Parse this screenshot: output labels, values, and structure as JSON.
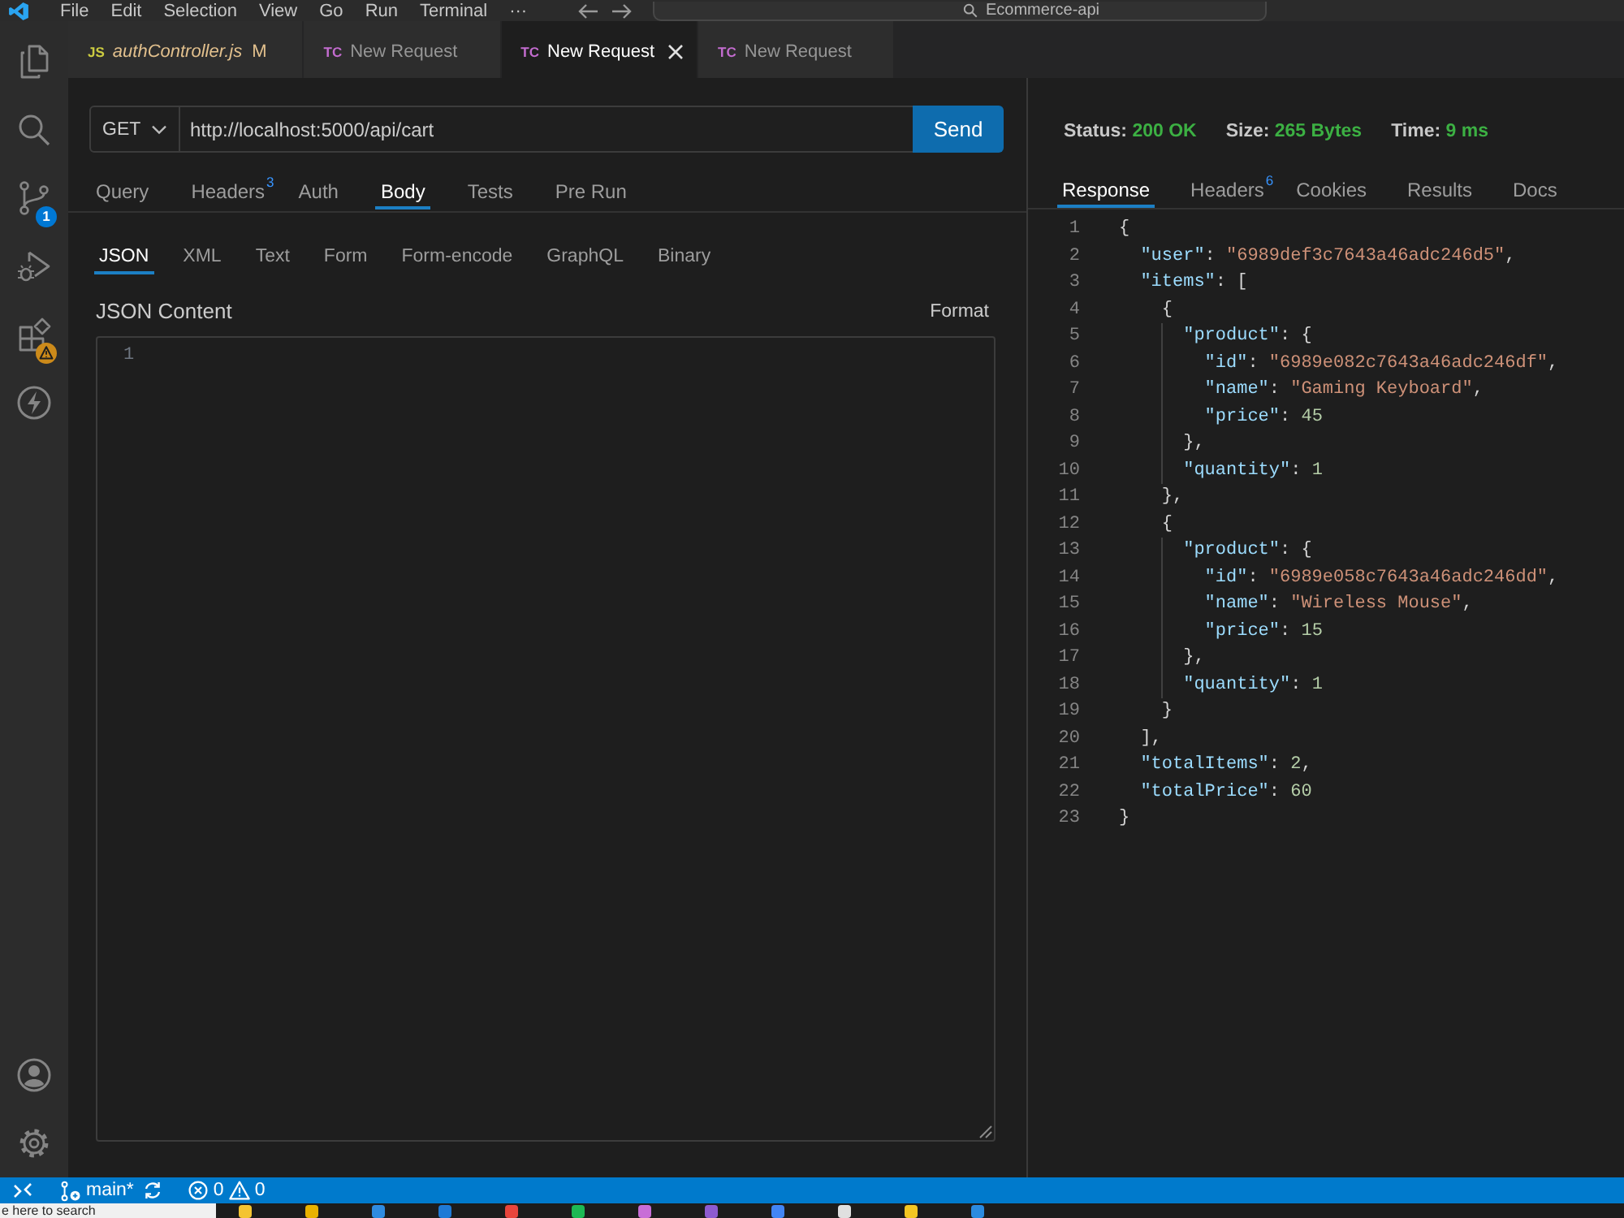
{
  "title_bar": {
    "menu": [
      "File",
      "Edit",
      "Selection",
      "View",
      "Go",
      "Run",
      "Terminal",
      "···"
    ],
    "search": {
      "value": "Ecommerce-api"
    }
  },
  "activity_bar": {
    "source_control_badge": "1",
    "extensions_warning": true
  },
  "editor_tabs": [
    {
      "kind": "js",
      "icon_text": "JS",
      "label": "authController.js",
      "preview": true,
      "status": "M",
      "selected": false
    },
    {
      "kind": "tc",
      "icon_text": "TC",
      "label": "New Request",
      "preview": false,
      "selected": false
    },
    {
      "kind": "tc",
      "icon_text": "TC",
      "label": "New Request",
      "preview": false,
      "selected": true
    },
    {
      "kind": "tc",
      "icon_text": "TC",
      "label": "New Request",
      "preview": false,
      "selected": false
    }
  ],
  "request": {
    "method": "GET",
    "url": "http://localhost:5000/api/cart",
    "send_label": "Send",
    "tabs": [
      {
        "label": "Query",
        "selected": false
      },
      {
        "label": "Headers",
        "count": "3",
        "selected": false
      },
      {
        "label": "Auth",
        "selected": false
      },
      {
        "label": "Body",
        "selected": true
      },
      {
        "label": "Tests",
        "selected": false
      },
      {
        "label": "Pre Run",
        "selected": false
      }
    ],
    "body_types": [
      {
        "label": "JSON",
        "selected": true
      },
      {
        "label": "XML",
        "selected": false
      },
      {
        "label": "Text",
        "selected": false
      },
      {
        "label": "Form",
        "selected": false
      },
      {
        "label": "Form-encode",
        "selected": false
      },
      {
        "label": "GraphQL",
        "selected": false
      },
      {
        "label": "Binary",
        "selected": false
      }
    ],
    "content": {
      "title": "JSON Content",
      "format_label": "Format",
      "line_numbers": [
        "1"
      ]
    }
  },
  "response": {
    "status": [
      {
        "label": "Status:",
        "value": "200 OK"
      },
      {
        "label": "Size:",
        "value": "265 Bytes"
      },
      {
        "label": "Time:",
        "value": "9 ms"
      }
    ],
    "tabs": [
      {
        "label": "Response",
        "selected": true
      },
      {
        "label": "Headers",
        "count": "6",
        "selected": false
      },
      {
        "label": "Cookies",
        "selected": false
      },
      {
        "label": "Results",
        "selected": false
      },
      {
        "label": "Docs",
        "selected": false
      }
    ],
    "lines": [
      {
        "number": "1",
        "tokens": [
          {
            "kind": "punct",
            "text": "{"
          }
        ],
        "children": [
          {
            "number": "2",
            "tokens": [
              {
                "kind": "key",
                "text": "\"user\""
              },
              {
                "kind": "punct",
                "text": ": "
              },
              {
                "kind": "string",
                "text": "\"6989def3c7643a46adc246d5\""
              },
              {
                "kind": "punct",
                "text": ","
              }
            ]
          },
          {
            "number": "3",
            "tokens": [
              {
                "kind": "key",
                "text": "\"items\""
              },
              {
                "kind": "punct",
                "text": ": ["
              }
            ],
            "children": [
              {
                "number": "4",
                "tokens": [
                  {
                    "kind": "punct",
                    "text": "{"
                  }
                ],
                "children": [
                  {
                    "number": "5",
                    "tokens": [
                      {
                        "kind": "key",
                        "text": "\"product\""
                      },
                      {
                        "kind": "punct",
                        "text": ": {"
                      }
                    ],
                    "children": [
                      {
                        "number": "6",
                        "tokens": [
                          {
                            "kind": "key",
                            "text": "\"id\""
                          },
                          {
                            "kind": "punct",
                            "text": ": "
                          },
                          {
                            "kind": "string",
                            "text": "\"6989e082c7643a46adc246df\""
                          },
                          {
                            "kind": "punct",
                            "text": ","
                          }
                        ]
                      },
                      {
                        "number": "7",
                        "tokens": [
                          {
                            "kind": "key",
                            "text": "\"name\""
                          },
                          {
                            "kind": "punct",
                            "text": ": "
                          },
                          {
                            "kind": "string",
                            "text": "\"Gaming Keyboard\""
                          },
                          {
                            "kind": "punct",
                            "text": ","
                          }
                        ]
                      },
                      {
                        "number": "8",
                        "tokens": [
                          {
                            "kind": "key",
                            "text": "\"price\""
                          },
                          {
                            "kind": "punct",
                            "text": ": "
                          },
                          {
                            "kind": "number",
                            "text": "45"
                          }
                        ]
                      }
                    ]
                  },
                  {
                    "number": "9",
                    "tokens": [
                      {
                        "kind": "punct",
                        "text": "},"
                      }
                    ]
                  },
                  {
                    "number": "10",
                    "tokens": [
                      {
                        "kind": "key",
                        "text": "\"quantity\""
                      },
                      {
                        "kind": "punct",
                        "text": ": "
                      },
                      {
                        "kind": "number",
                        "text": "1"
                      }
                    ]
                  }
                ]
              },
              {
                "number": "11",
                "tokens": [
                  {
                    "kind": "punct",
                    "text": "},"
                  }
                ]
              },
              {
                "number": "12",
                "tokens": [
                  {
                    "kind": "punct",
                    "text": "{"
                  }
                ],
                "children": [
                  {
                    "number": "13",
                    "tokens": [
                      {
                        "kind": "key",
                        "text": "\"product\""
                      },
                      {
                        "kind": "punct",
                        "text": ": {"
                      }
                    ],
                    "children": [
                      {
                        "number": "14",
                        "tokens": [
                          {
                            "kind": "key",
                            "text": "\"id\""
                          },
                          {
                            "kind": "punct",
                            "text": ": "
                          },
                          {
                            "kind": "string",
                            "text": "\"6989e058c7643a46adc246dd\""
                          },
                          {
                            "kind": "punct",
                            "text": ","
                          }
                        ]
                      },
                      {
                        "number": "15",
                        "tokens": [
                          {
                            "kind": "key",
                            "text": "\"name\""
                          },
                          {
                            "kind": "punct",
                            "text": ": "
                          },
                          {
                            "kind": "string",
                            "text": "\"Wireless Mouse\""
                          },
                          {
                            "kind": "punct",
                            "text": ","
                          }
                        ]
                      },
                      {
                        "number": "16",
                        "tokens": [
                          {
                            "kind": "key",
                            "text": "\"price\""
                          },
                          {
                            "kind": "punct",
                            "text": ": "
                          },
                          {
                            "kind": "number",
                            "text": "15"
                          }
                        ]
                      }
                    ]
                  },
                  {
                    "number": "17",
                    "tokens": [
                      {
                        "kind": "punct",
                        "text": "},"
                      }
                    ]
                  },
                  {
                    "number": "18",
                    "tokens": [
                      {
                        "kind": "key",
                        "text": "\"quantity\""
                      },
                      {
                        "kind": "punct",
                        "text": ": "
                      },
                      {
                        "kind": "number",
                        "text": "1"
                      }
                    ]
                  }
                ]
              },
              {
                "number": "19",
                "tokens": [
                  {
                    "kind": "punct",
                    "text": "}"
                  }
                ]
              }
            ]
          },
          {
            "number": "20",
            "tokens": [
              {
                "kind": "punct",
                "text": "],"
              }
            ]
          },
          {
            "number": "21",
            "tokens": [
              {
                "kind": "key",
                "text": "\"totalItems\""
              },
              {
                "kind": "punct",
                "text": ": "
              },
              {
                "kind": "number",
                "text": "2"
              },
              {
                "kind": "punct",
                "text": ","
              }
            ]
          },
          {
            "number": "22",
            "tokens": [
              {
                "kind": "key",
                "text": "\"totalPrice\""
              },
              {
                "kind": "punct",
                "text": ": "
              },
              {
                "kind": "number",
                "text": "60"
              }
            ]
          }
        ]
      },
      {
        "number": "23",
        "tokens": [
          {
            "kind": "punct",
            "text": "}"
          }
        ]
      }
    ]
  },
  "status_bar": {
    "branch": "main*",
    "errors": "0",
    "warnings": "0"
  },
  "taskbar": {
    "search": {
      "placeholder": "e here to search"
    }
  }
}
